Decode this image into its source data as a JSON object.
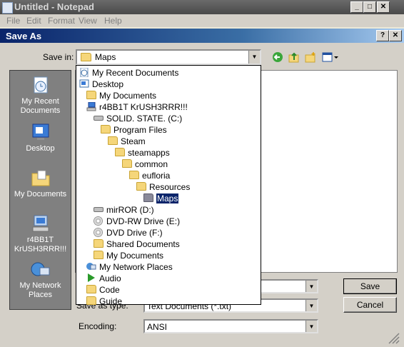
{
  "notepad": {
    "title": "Untitled - Notepad",
    "menu": [
      "File",
      "Edit",
      "Format",
      "View",
      "Help"
    ]
  },
  "dialog": {
    "title": "Save As",
    "save_in_label": "Save in:",
    "save_in_value": "Maps",
    "places": [
      "My Recent Documents",
      "Desktop",
      "My Documents",
      "r4BB1T KrUSH3RRR!!!",
      "My Network Places"
    ],
    "save_as_type_label": "Save as type:",
    "save_as_type_value": "Text Documents (*.txt)",
    "encoding_label": "Encoding:",
    "encoding_value": "ANSI",
    "save_button": "Save",
    "cancel_button": "Cancel"
  },
  "dropdown": {
    "items": [
      {
        "label": "My Recent Documents",
        "icon": "recent-icon"
      },
      {
        "label": "Desktop",
        "icon": "desktop-icon"
      },
      {
        "label": "My Documents",
        "icon": "folder-icon"
      },
      {
        "label": "r4BB1T KrUSH3RRR!!!",
        "icon": "computer-icon"
      },
      {
        "label": "SOLID. STATE. (C:)",
        "icon": "drive-icon"
      },
      {
        "label": "Program Files",
        "icon": "folder-icon"
      },
      {
        "label": "Steam",
        "icon": "folder-icon"
      },
      {
        "label": "steamapps",
        "icon": "folder-icon"
      },
      {
        "label": "common",
        "icon": "folder-icon"
      },
      {
        "label": "eufloria",
        "icon": "folder-icon"
      },
      {
        "label": "Resources",
        "icon": "folder-icon"
      },
      {
        "label": "Maps",
        "icon": "open-folder-icon",
        "selected": true
      },
      {
        "label": "mirROR (D:)",
        "icon": "drive-icon"
      },
      {
        "label": "DVD-RW Drive (E:)",
        "icon": "dvd-icon"
      },
      {
        "label": "DVD Drive (F:)",
        "icon": "dvd-icon"
      },
      {
        "label": "Shared Documents",
        "icon": "folder-icon"
      },
      {
        "label": "My Documents",
        "icon": "folder-icon"
      },
      {
        "label": "My Network Places",
        "icon": "network-icon"
      },
      {
        "label": "Audio",
        "icon": "play-icon"
      },
      {
        "label": "Code",
        "icon": "folder-icon"
      },
      {
        "label": "Guide",
        "icon": "folder-icon"
      }
    ]
  }
}
